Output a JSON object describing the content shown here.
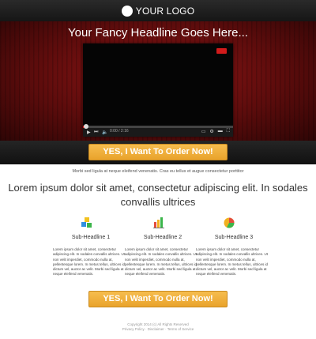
{
  "header": {
    "logo_text": "YOUR LOGO"
  },
  "hero": {
    "headline": "Your Fancy Headline Goes Here...",
    "video": {
      "time": "0:00 / 2:16"
    }
  },
  "cta": {
    "label": "YES, I Want To Order Now!"
  },
  "intro": {
    "subline": "Morbi sed ligula at neque eleifend venenatis. Cras eu tellus et augue consectetur porttitor"
  },
  "main": {
    "lead": "Lorem ipsum dolor sit amet, consectetur adipiscing elit. In sodales convallis ultrices"
  },
  "columns": [
    {
      "title": "Sub-Headline 1",
      "icon": "blocks-icon",
      "text": "Lorem ipsum dolor sit amet, consectetur adipiscing elit. In sodales convallis ultrices. Ut non velit imperdiet, commodo nulla at, pellentesque lorem. In metus tellus, ultrices id dictum vel, auctor ac velit. Morbi sed ligula at neque eleifend venenatis."
    },
    {
      "title": "Sub-Headline 2",
      "icon": "bar-chart-icon",
      "text": "Lorem ipsum dolor sit amet, consectetur adipiscing elit. In sodales convallis ultrices. Ut non velit imperdiet, commodo nulla at, pellentesque lorem. In metus tellus, ultrices id dictum vel, auctor ac velit. Morbi sed ligula at neque eleifend venenatis."
    },
    {
      "title": "Sub-Headline 3",
      "icon": "pie-chart-icon",
      "text": "Lorem ipsum dolor sit amet, consectetur adipiscing elit. In sodales convallis ultrices. Ut non velit imperdiet, commodo nulla at, pellentesque lorem. In metus tellus, ultrices id dictum vel, auctor ac velit. Morbi sed ligula at neque eleifend venenatis."
    }
  ],
  "footer": {
    "copyright": "Copyright 2014 (c) All Rights Reserved",
    "links": "Privacy Policy  ·  Disclaimer  ·  Terms of Service"
  },
  "colors": {
    "accent": "#efab38",
    "hero_red": "#8e1616",
    "dark_band": "#1b1b1b"
  }
}
